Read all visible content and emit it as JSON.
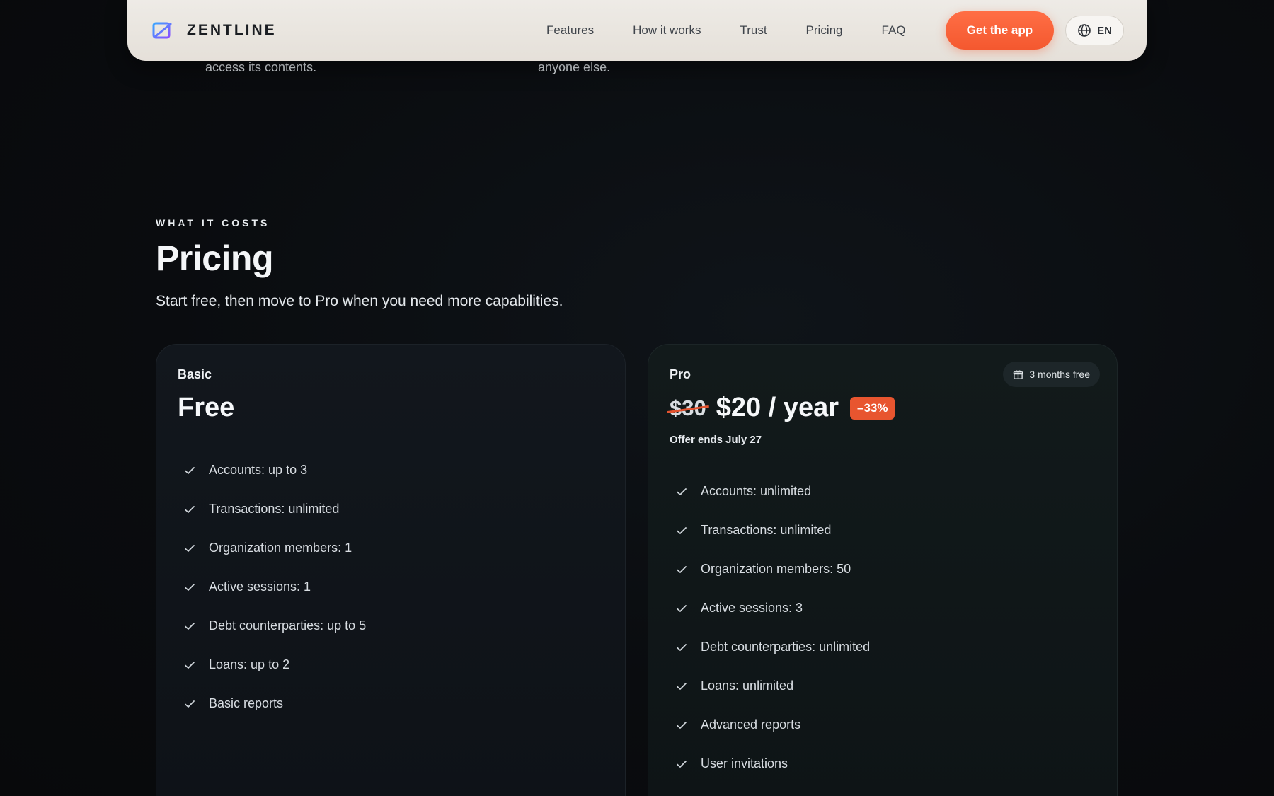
{
  "header": {
    "logo_text": "ZENTLINE",
    "nav": [
      "Features",
      "How it works",
      "Trust",
      "Pricing",
      "FAQ"
    ],
    "cta_label": "Get the app",
    "lang_label": "EN"
  },
  "previous_section": {
    "col1_last_line": "access its contents.",
    "col2_last_line": "anyone else."
  },
  "pricing": {
    "eyebrow": "WHAT IT COSTS",
    "title": "Pricing",
    "subtitle": "Start free, then move to Pro when you need more capabilities.",
    "basic": {
      "name": "Basic",
      "price": "Free",
      "features": [
        "Accounts: up to 3",
        "Transactions: unlimited",
        "Organization members: 1",
        "Active sessions: 1",
        "Debt counterparties: up to 5",
        "Loans: up to 2",
        "Basic reports"
      ]
    },
    "pro": {
      "name": "Pro",
      "badge": "3 months free",
      "old_price": "$30",
      "price": "$20 / year",
      "discount": "–33%",
      "offer_ends": "Offer ends July 27",
      "features": [
        "Accounts: unlimited",
        "Transactions: unlimited",
        "Organization members: 50",
        "Active sessions: 3",
        "Debt counterparties: unlimited",
        "Loans: unlimited",
        "Advanced reports",
        "User invitations"
      ]
    }
  },
  "colors": {
    "accent": "#f4582f",
    "background": "#0b0d10",
    "header_bg": "#eeebe6"
  }
}
